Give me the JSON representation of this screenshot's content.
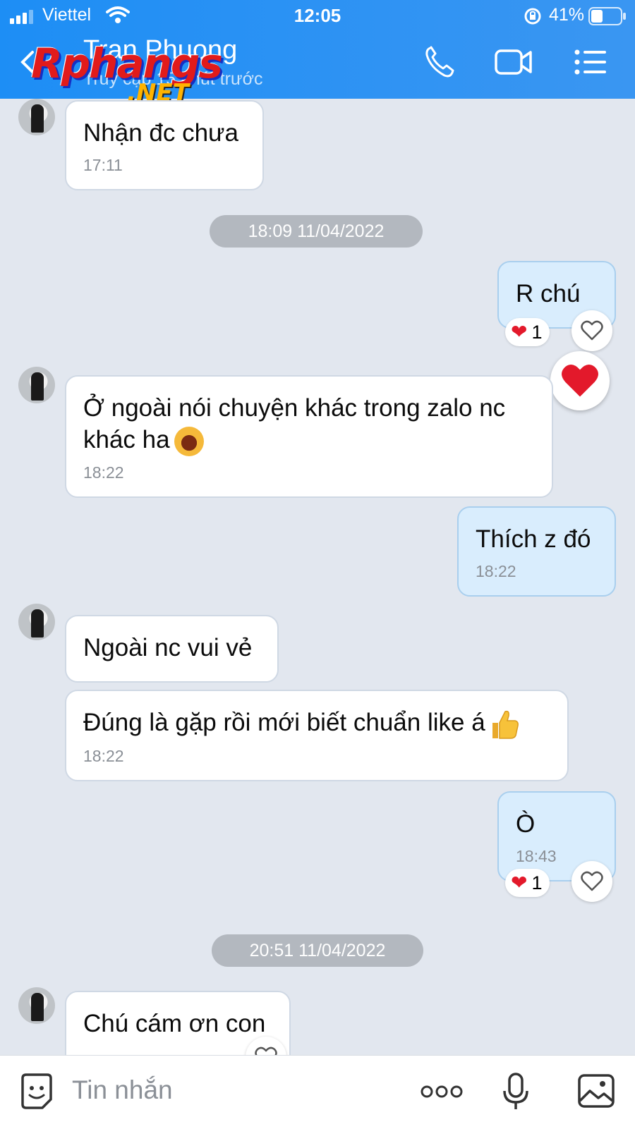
{
  "status_bar": {
    "carrier": "Viettel",
    "time": "12:05",
    "battery_percent": "41%",
    "battery_level": 0.41,
    "signal_bars": 3
  },
  "header": {
    "contact_name": "Tran Phuong",
    "contact_status": "Truy cập 15 phút trước",
    "watermark": "Rphangs",
    "watermark_suffix": ".NET",
    "icons": [
      "back-icon",
      "phone-icon",
      "video-call-icon",
      "menu-icon"
    ]
  },
  "messages": [
    {
      "from": "them",
      "text": "Nhận đc chưa",
      "time": "17:11"
    },
    {
      "type": "date",
      "text": "18:09 11/04/2022"
    },
    {
      "from": "me",
      "text": "R chú",
      "reaction": "1"
    },
    {
      "from": "them",
      "text": "Ở ngoài nói chuyện khác trong zalo nc khác ha",
      "time": "18:22"
    },
    {
      "from": "me",
      "text": "Thích z đó",
      "time": "18:22"
    },
    {
      "from": "them",
      "text": "Ngoài nc vui vẻ"
    },
    {
      "from": "them",
      "text": "Đúng là gặp rồi mới biết chuẩn like á",
      "time": "18:22"
    },
    {
      "from": "me",
      "text": "Ò",
      "time": "18:43",
      "reaction": "1"
    },
    {
      "type": "date",
      "text": "20:51 11/04/2022"
    },
    {
      "from": "them",
      "text": "Chú cám ơn con"
    }
  ],
  "input": {
    "placeholder": "Tin nhắn",
    "icons": [
      "sticker-icon",
      "more-icon",
      "microphone-icon",
      "image-icon"
    ]
  },
  "colors": {
    "header": "#2f93f3",
    "my_bubble": "#d9edfd",
    "their_bubble": "#ffffff",
    "background": "#e2e7ef",
    "heart": "#e3192b"
  }
}
